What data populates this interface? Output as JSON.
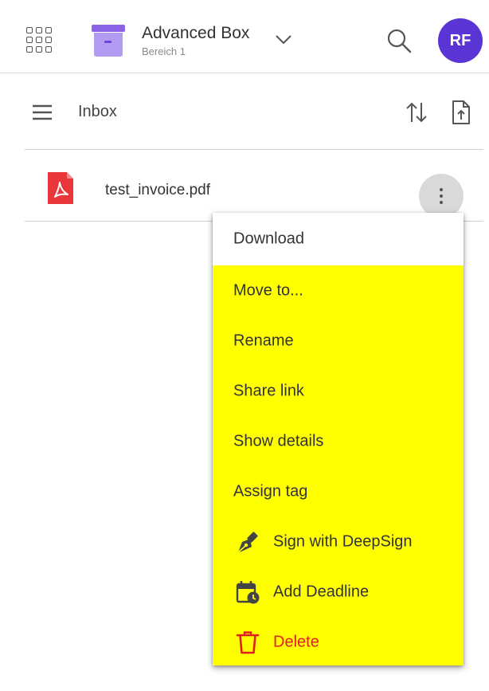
{
  "header": {
    "workspace_title": "Advanced Box",
    "workspace_subtitle": "Bereich 1",
    "avatar_initials": "RF",
    "accent_color": "#5b34d6",
    "icons": [
      "apps-grid-icon",
      "archive-box-icon",
      "chevron-down-icon",
      "search-icon"
    ]
  },
  "folder": {
    "title": "Inbox",
    "icons": [
      "hamburger-menu-icon",
      "sort-icon",
      "upload-file-icon"
    ]
  },
  "files": [
    {
      "name": "test_invoice.pdf",
      "icon": "pdf-file-icon"
    }
  ],
  "context_menu": {
    "highlight_color": "#ffff00",
    "items": [
      {
        "label": "Download"
      },
      {
        "label": "Move to..."
      },
      {
        "label": "Rename"
      },
      {
        "label": "Share link"
      },
      {
        "label": "Show details"
      },
      {
        "label": "Assign tag"
      },
      {
        "label": "Sign with DeepSign",
        "icon": "pen-sign-icon"
      },
      {
        "label": "Add Deadline",
        "icon": "calendar-clock-icon"
      },
      {
        "label": "Delete",
        "icon": "trash-icon",
        "color": "#e02020"
      }
    ]
  }
}
